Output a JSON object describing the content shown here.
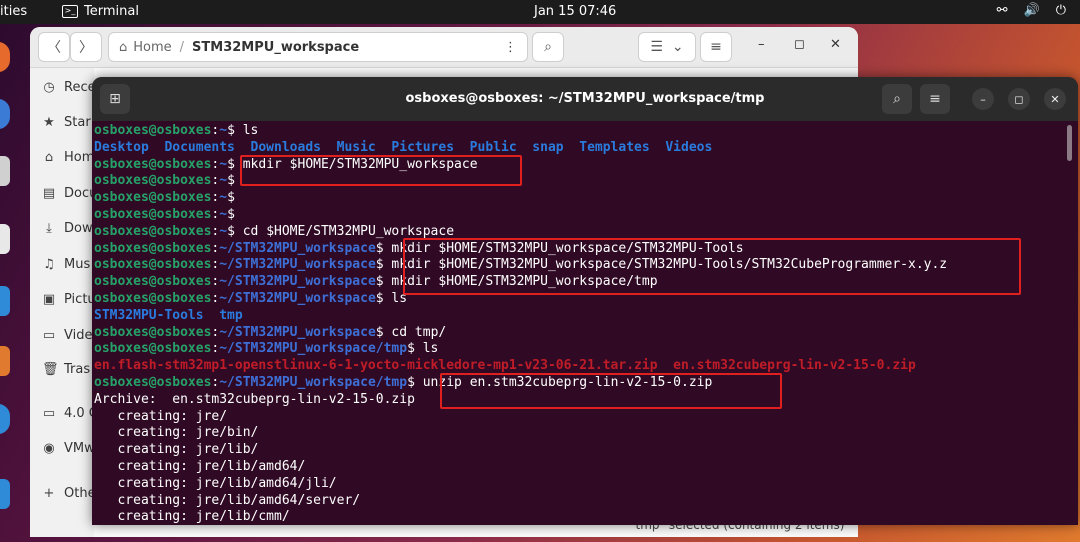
{
  "topbar": {
    "activities": "ities",
    "app_name": "Terminal",
    "clock": "Jan 15  07:46"
  },
  "files": {
    "path_home": "Home",
    "path_current": "STM32MPU_workspace",
    "sidebar": [
      {
        "icon": "clock-icon",
        "glyph": "◷",
        "label": "Rece"
      },
      {
        "icon": "star-icon",
        "glyph": "★",
        "label": "Star"
      },
      {
        "icon": "home-icon",
        "glyph": "⌂",
        "label": "Hom"
      },
      {
        "icon": "document-icon",
        "glyph": "▤",
        "label": "Docu"
      },
      {
        "icon": "download-icon",
        "glyph": "⤓",
        "label": "Dow"
      },
      {
        "icon": "music-icon",
        "glyph": "♫",
        "label": "Mus"
      },
      {
        "icon": "pictures-icon",
        "glyph": "▣",
        "label": "Pictu"
      },
      {
        "icon": "video-icon",
        "glyph": "▭",
        "label": "Vide"
      },
      {
        "icon": "trash-icon",
        "glyph": "🗑",
        "label": "Tras"
      },
      {
        "icon": "drive-icon",
        "glyph": "▭",
        "label": "4.0 G"
      },
      {
        "icon": "disc-icon",
        "glyph": "◉",
        "label": "VMw"
      },
      {
        "icon": "plus-icon",
        "glyph": "+",
        "label": "Othe"
      }
    ],
    "status": "\"tmp\" selected  (containing 2 items)"
  },
  "terminal": {
    "title": "osboxes@osboxes: ~/STM32MPU_workspace/tmp",
    "lines": [
      [
        {
          "c": "u",
          "t": "osboxes@osboxes"
        },
        {
          "c": "",
          "t": ":"
        },
        {
          "c": "p",
          "t": "~"
        },
        {
          "c": "",
          "t": "$ ls"
        }
      ],
      [
        {
          "c": "dir",
          "t": "Desktop  Documents  Downloads  Music  Pictures  Public  snap  Templates  Videos"
        }
      ],
      [
        {
          "c": "u",
          "t": "osboxes@osboxes"
        },
        {
          "c": "",
          "t": ":"
        },
        {
          "c": "p",
          "t": "~"
        },
        {
          "c": "",
          "t": "$ mkdir $HOME/STM32MPU_workspace"
        }
      ],
      [
        {
          "c": "u",
          "t": "osboxes@osboxes"
        },
        {
          "c": "",
          "t": ":"
        },
        {
          "c": "p",
          "t": "~"
        },
        {
          "c": "",
          "t": "$"
        }
      ],
      [
        {
          "c": "u",
          "t": "osboxes@osboxes"
        },
        {
          "c": "",
          "t": ":"
        },
        {
          "c": "p",
          "t": "~"
        },
        {
          "c": "",
          "t": "$"
        }
      ],
      [
        {
          "c": "u",
          "t": "osboxes@osboxes"
        },
        {
          "c": "",
          "t": ":"
        },
        {
          "c": "p",
          "t": "~"
        },
        {
          "c": "",
          "t": "$"
        }
      ],
      [
        {
          "c": "u",
          "t": "osboxes@osboxes"
        },
        {
          "c": "",
          "t": ":"
        },
        {
          "c": "p",
          "t": "~"
        },
        {
          "c": "",
          "t": "$ cd $HOME/STM32MPU_workspace"
        }
      ],
      [
        {
          "c": "u",
          "t": "osboxes@osboxes"
        },
        {
          "c": "",
          "t": ":"
        },
        {
          "c": "p",
          "t": "~/STM32MPU_workspace"
        },
        {
          "c": "",
          "t": "$ mkdir $HOME/STM32MPU_workspace/STM32MPU-Tools"
        }
      ],
      [
        {
          "c": "u",
          "t": "osboxes@osboxes"
        },
        {
          "c": "",
          "t": ":"
        },
        {
          "c": "p",
          "t": "~/STM32MPU_workspace"
        },
        {
          "c": "",
          "t": "$ mkdir $HOME/STM32MPU_workspace/STM32MPU-Tools/STM32CubeProgrammer-x.y.z"
        }
      ],
      [
        {
          "c": "u",
          "t": "osboxes@osboxes"
        },
        {
          "c": "",
          "t": ":"
        },
        {
          "c": "p",
          "t": "~/STM32MPU_workspace"
        },
        {
          "c": "",
          "t": "$ mkdir $HOME/STM32MPU_workspace/tmp"
        }
      ],
      [
        {
          "c": "u",
          "t": "osboxes@osboxes"
        },
        {
          "c": "",
          "t": ":"
        },
        {
          "c": "p",
          "t": "~/STM32MPU_workspace"
        },
        {
          "c": "",
          "t": "$ ls"
        }
      ],
      [
        {
          "c": "dir",
          "t": "STM32MPU-Tools  tmp"
        }
      ],
      [
        {
          "c": "u",
          "t": "osboxes@osboxes"
        },
        {
          "c": "",
          "t": ":"
        },
        {
          "c": "p",
          "t": "~/STM32MPU_workspace"
        },
        {
          "c": "",
          "t": "$ cd tmp/"
        }
      ],
      [
        {
          "c": "u",
          "t": "osboxes@osboxes"
        },
        {
          "c": "",
          "t": ":"
        },
        {
          "c": "p",
          "t": "~/STM32MPU_workspace/tmp"
        },
        {
          "c": "",
          "t": "$ ls"
        }
      ],
      [
        {
          "c": "red",
          "t": "en.flash-stm32mp1-openstlinux-6-1-yocto-mickledore-mp1-v23-06-21.tar.zip  en.stm32cubeprg-lin-v2-15-0.zip"
        }
      ],
      [
        {
          "c": "u",
          "t": "osboxes@osboxes"
        },
        {
          "c": "",
          "t": ":"
        },
        {
          "c": "p",
          "t": "~/STM32MPU_workspace/tmp"
        },
        {
          "c": "",
          "t": "$ unzip en.stm32cubeprg-lin-v2-15-0.zip"
        }
      ],
      [
        {
          "c": "",
          "t": "Archive:  en.stm32cubeprg-lin-v2-15-0.zip"
        }
      ],
      [
        {
          "c": "",
          "t": "   creating: jre/"
        }
      ],
      [
        {
          "c": "",
          "t": "   creating: jre/bin/"
        }
      ],
      [
        {
          "c": "",
          "t": "   creating: jre/lib/"
        }
      ],
      [
        {
          "c": "",
          "t": "   creating: jre/lib/amd64/"
        }
      ],
      [
        {
          "c": "",
          "t": "   creating: jre/lib/amd64/jli/"
        }
      ],
      [
        {
          "c": "",
          "t": "   creating: jre/lib/amd64/server/"
        }
      ],
      [
        {
          "c": "",
          "t": "   creating: jre/lib/cmm/"
        }
      ]
    ]
  }
}
